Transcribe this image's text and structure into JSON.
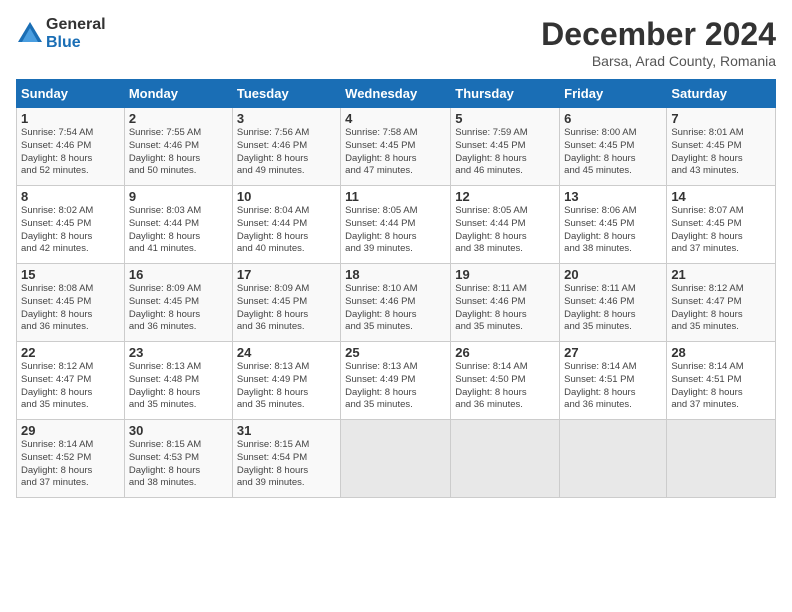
{
  "header": {
    "logo_line1": "General",
    "logo_line2": "Blue",
    "month_title": "December 2024",
    "location": "Barsa, Arad County, Romania"
  },
  "weekdays": [
    "Sunday",
    "Monday",
    "Tuesday",
    "Wednesday",
    "Thursday",
    "Friday",
    "Saturday"
  ],
  "weeks": [
    [
      {
        "day": "1",
        "info": "Sunrise: 7:54 AM\nSunset: 4:46 PM\nDaylight: 8 hours\nand 52 minutes."
      },
      {
        "day": "2",
        "info": "Sunrise: 7:55 AM\nSunset: 4:46 PM\nDaylight: 8 hours\nand 50 minutes."
      },
      {
        "day": "3",
        "info": "Sunrise: 7:56 AM\nSunset: 4:46 PM\nDaylight: 8 hours\nand 49 minutes."
      },
      {
        "day": "4",
        "info": "Sunrise: 7:58 AM\nSunset: 4:45 PM\nDaylight: 8 hours\nand 47 minutes."
      },
      {
        "day": "5",
        "info": "Sunrise: 7:59 AM\nSunset: 4:45 PM\nDaylight: 8 hours\nand 46 minutes."
      },
      {
        "day": "6",
        "info": "Sunrise: 8:00 AM\nSunset: 4:45 PM\nDaylight: 8 hours\nand 45 minutes."
      },
      {
        "day": "7",
        "info": "Sunrise: 8:01 AM\nSunset: 4:45 PM\nDaylight: 8 hours\nand 43 minutes."
      }
    ],
    [
      {
        "day": "8",
        "info": "Sunrise: 8:02 AM\nSunset: 4:45 PM\nDaylight: 8 hours\nand 42 minutes."
      },
      {
        "day": "9",
        "info": "Sunrise: 8:03 AM\nSunset: 4:44 PM\nDaylight: 8 hours\nand 41 minutes."
      },
      {
        "day": "10",
        "info": "Sunrise: 8:04 AM\nSunset: 4:44 PM\nDaylight: 8 hours\nand 40 minutes."
      },
      {
        "day": "11",
        "info": "Sunrise: 8:05 AM\nSunset: 4:44 PM\nDaylight: 8 hours\nand 39 minutes."
      },
      {
        "day": "12",
        "info": "Sunrise: 8:05 AM\nSunset: 4:44 PM\nDaylight: 8 hours\nand 38 minutes."
      },
      {
        "day": "13",
        "info": "Sunrise: 8:06 AM\nSunset: 4:45 PM\nDaylight: 8 hours\nand 38 minutes."
      },
      {
        "day": "14",
        "info": "Sunrise: 8:07 AM\nSunset: 4:45 PM\nDaylight: 8 hours\nand 37 minutes."
      }
    ],
    [
      {
        "day": "15",
        "info": "Sunrise: 8:08 AM\nSunset: 4:45 PM\nDaylight: 8 hours\nand 36 minutes."
      },
      {
        "day": "16",
        "info": "Sunrise: 8:09 AM\nSunset: 4:45 PM\nDaylight: 8 hours\nand 36 minutes."
      },
      {
        "day": "17",
        "info": "Sunrise: 8:09 AM\nSunset: 4:45 PM\nDaylight: 8 hours\nand 36 minutes."
      },
      {
        "day": "18",
        "info": "Sunrise: 8:10 AM\nSunset: 4:46 PM\nDaylight: 8 hours\nand 35 minutes."
      },
      {
        "day": "19",
        "info": "Sunrise: 8:11 AM\nSunset: 4:46 PM\nDaylight: 8 hours\nand 35 minutes."
      },
      {
        "day": "20",
        "info": "Sunrise: 8:11 AM\nSunset: 4:46 PM\nDaylight: 8 hours\nand 35 minutes."
      },
      {
        "day": "21",
        "info": "Sunrise: 8:12 AM\nSunset: 4:47 PM\nDaylight: 8 hours\nand 35 minutes."
      }
    ],
    [
      {
        "day": "22",
        "info": "Sunrise: 8:12 AM\nSunset: 4:47 PM\nDaylight: 8 hours\nand 35 minutes."
      },
      {
        "day": "23",
        "info": "Sunrise: 8:13 AM\nSunset: 4:48 PM\nDaylight: 8 hours\nand 35 minutes."
      },
      {
        "day": "24",
        "info": "Sunrise: 8:13 AM\nSunset: 4:49 PM\nDaylight: 8 hours\nand 35 minutes."
      },
      {
        "day": "25",
        "info": "Sunrise: 8:13 AM\nSunset: 4:49 PM\nDaylight: 8 hours\nand 35 minutes."
      },
      {
        "day": "26",
        "info": "Sunrise: 8:14 AM\nSunset: 4:50 PM\nDaylight: 8 hours\nand 36 minutes."
      },
      {
        "day": "27",
        "info": "Sunrise: 8:14 AM\nSunset: 4:51 PM\nDaylight: 8 hours\nand 36 minutes."
      },
      {
        "day": "28",
        "info": "Sunrise: 8:14 AM\nSunset: 4:51 PM\nDaylight: 8 hours\nand 37 minutes."
      }
    ],
    [
      {
        "day": "29",
        "info": "Sunrise: 8:14 AM\nSunset: 4:52 PM\nDaylight: 8 hours\nand 37 minutes."
      },
      {
        "day": "30",
        "info": "Sunrise: 8:15 AM\nSunset: 4:53 PM\nDaylight: 8 hours\nand 38 minutes."
      },
      {
        "day": "31",
        "info": "Sunrise: 8:15 AM\nSunset: 4:54 PM\nDaylight: 8 hours\nand 39 minutes."
      },
      {
        "day": "",
        "info": ""
      },
      {
        "day": "",
        "info": ""
      },
      {
        "day": "",
        "info": ""
      },
      {
        "day": "",
        "info": ""
      }
    ]
  ]
}
